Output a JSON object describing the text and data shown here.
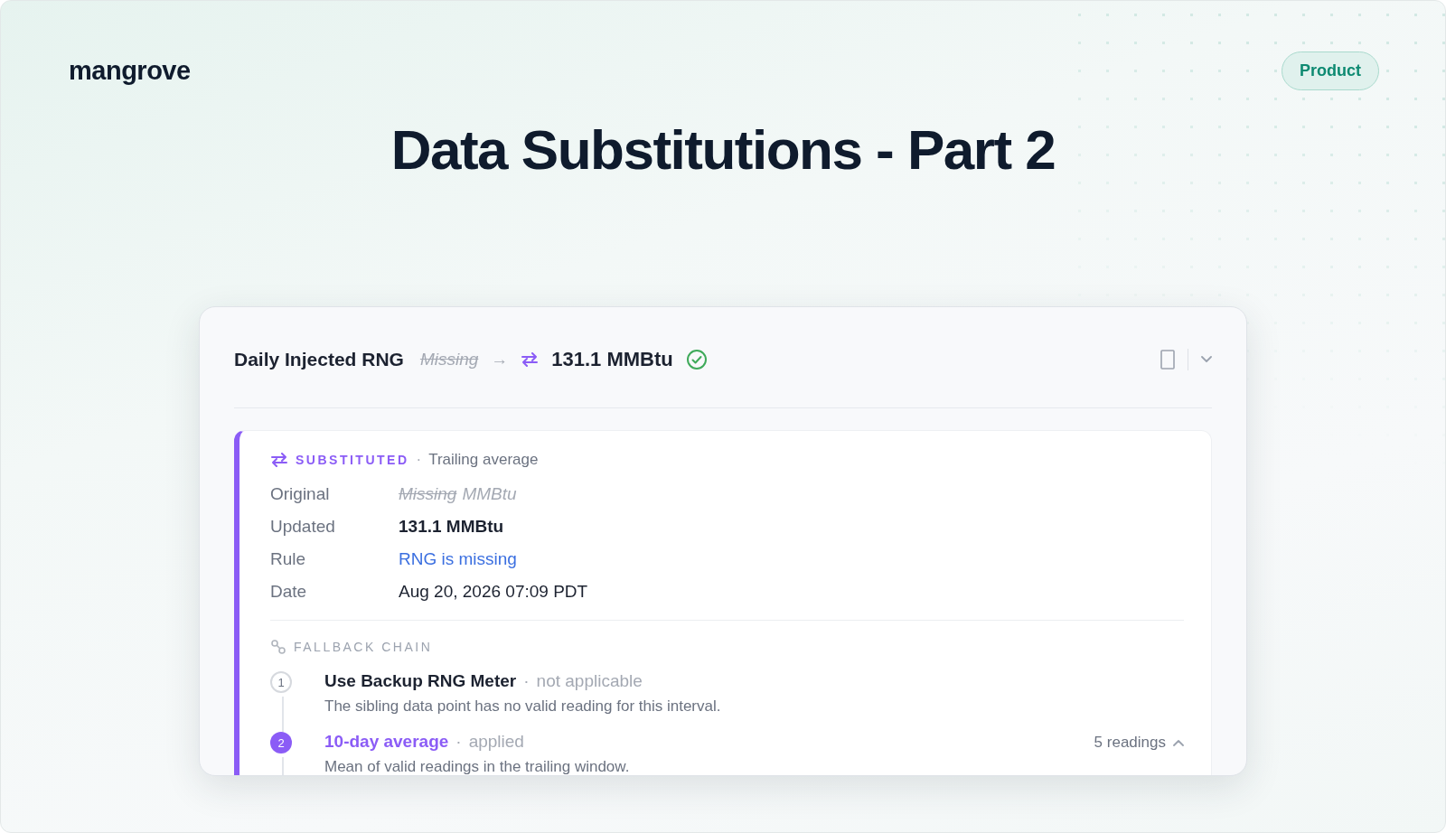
{
  "brand": "mangrove",
  "tag": "Product",
  "title": "Data Substitutions - Part 2",
  "card": {
    "metric": "Daily Injected RNG",
    "original": "Missing",
    "arrow": "→",
    "value": "131.1 MMBtu",
    "verified": true,
    "expanded": true,
    "detail": {
      "badge": "SUBSTITUTED",
      "separator": "·",
      "method": "Trailing average",
      "fields": [
        {
          "label": "Original",
          "kind": "struck",
          "value": "Missing",
          "unit": "MMBtu"
        },
        {
          "label": "Updated",
          "kind": "strong",
          "value": "131.1 MMBtu"
        },
        {
          "label": "Rule",
          "kind": "link",
          "value": "RNG is missing"
        },
        {
          "label": "Date",
          "kind": "plain",
          "value": "Aug 20, 2026 07:09 PDT"
        }
      ],
      "chain": {
        "heading": "FALLBACK CHAIN",
        "steps": [
          {
            "number": "1",
            "name": "Use Backup RNG Meter",
            "status": "not applicable",
            "description": "The sibling data point has no valid reading for this interval.",
            "applied": false
          },
          {
            "number": "2",
            "name": "10-day average",
            "status": "applied",
            "description": "Mean of valid readings in the trailing window.",
            "applied": true,
            "readings": "5 readings",
            "expanded": true
          }
        ]
      }
    }
  }
}
